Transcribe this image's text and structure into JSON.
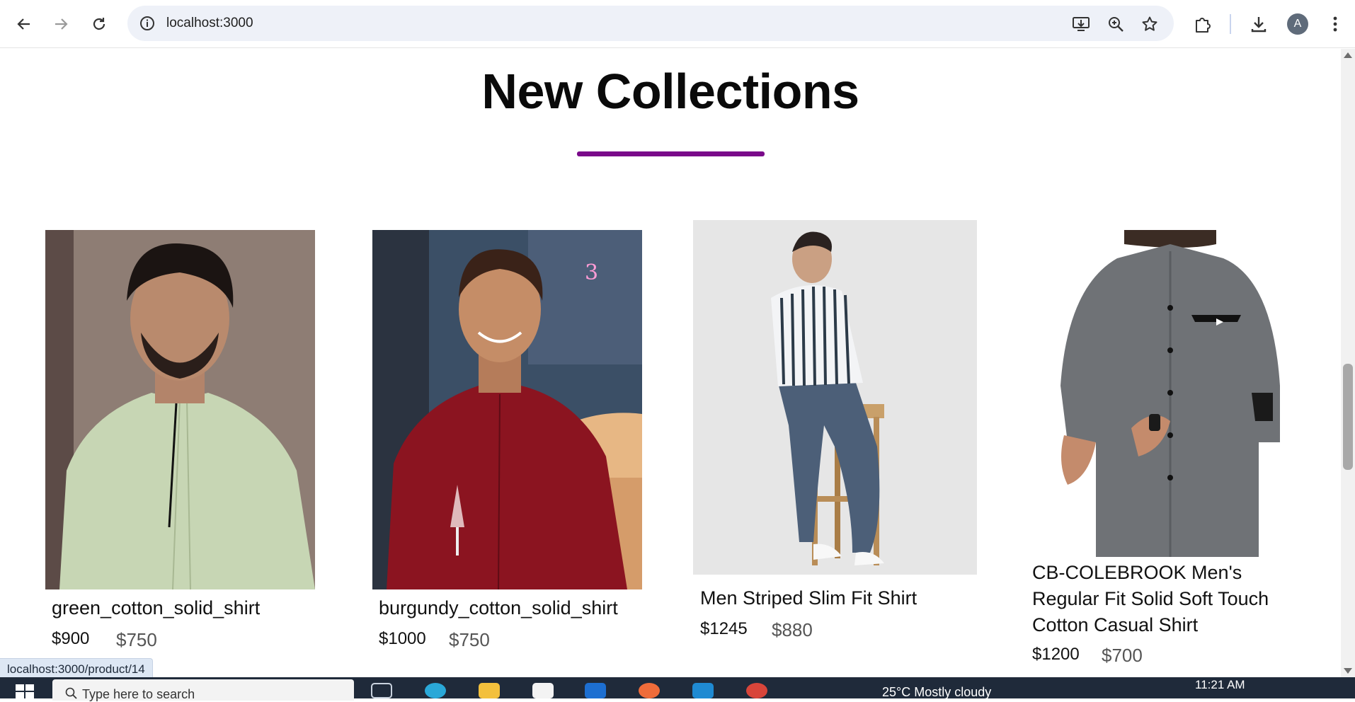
{
  "browser": {
    "url": "localhost:3000",
    "avatar_letter": "A"
  },
  "page": {
    "heading": "New Collections",
    "accent_color": "#7a0a8a"
  },
  "products": [
    {
      "title": "green_cotton_solid_shirt",
      "price_new": "$900",
      "price_old": "$750",
      "shirt_color": "#c7d6b4",
      "backdrop": "#8e7d74"
    },
    {
      "title": "burgundy_cotton_solid_shirt",
      "price_new": "$1000",
      "price_old": "$750",
      "shirt_color": "#8b1420",
      "backdrop": "#3b4f66"
    },
    {
      "title": "Men Striped Slim Fit Shirt",
      "price_new": "$1245",
      "price_old": "$880",
      "shirt_color": "#e9edf2",
      "backdrop": "#e6e6e6"
    },
    {
      "title": "CB-COLEBROOK Men's Regular Fit Solid Soft Touch Cotton Casual Shirt",
      "price_new": "$1200",
      "price_old": "$700",
      "shirt_color": "#6f7276",
      "backdrop": "#ffffff"
    }
  ],
  "status_link": "localhost:3000/product/14",
  "taskbar": {
    "search_placeholder": "Type here to search",
    "weather": "25°C  Mostly cloudy",
    "time": "11:21 AM"
  }
}
